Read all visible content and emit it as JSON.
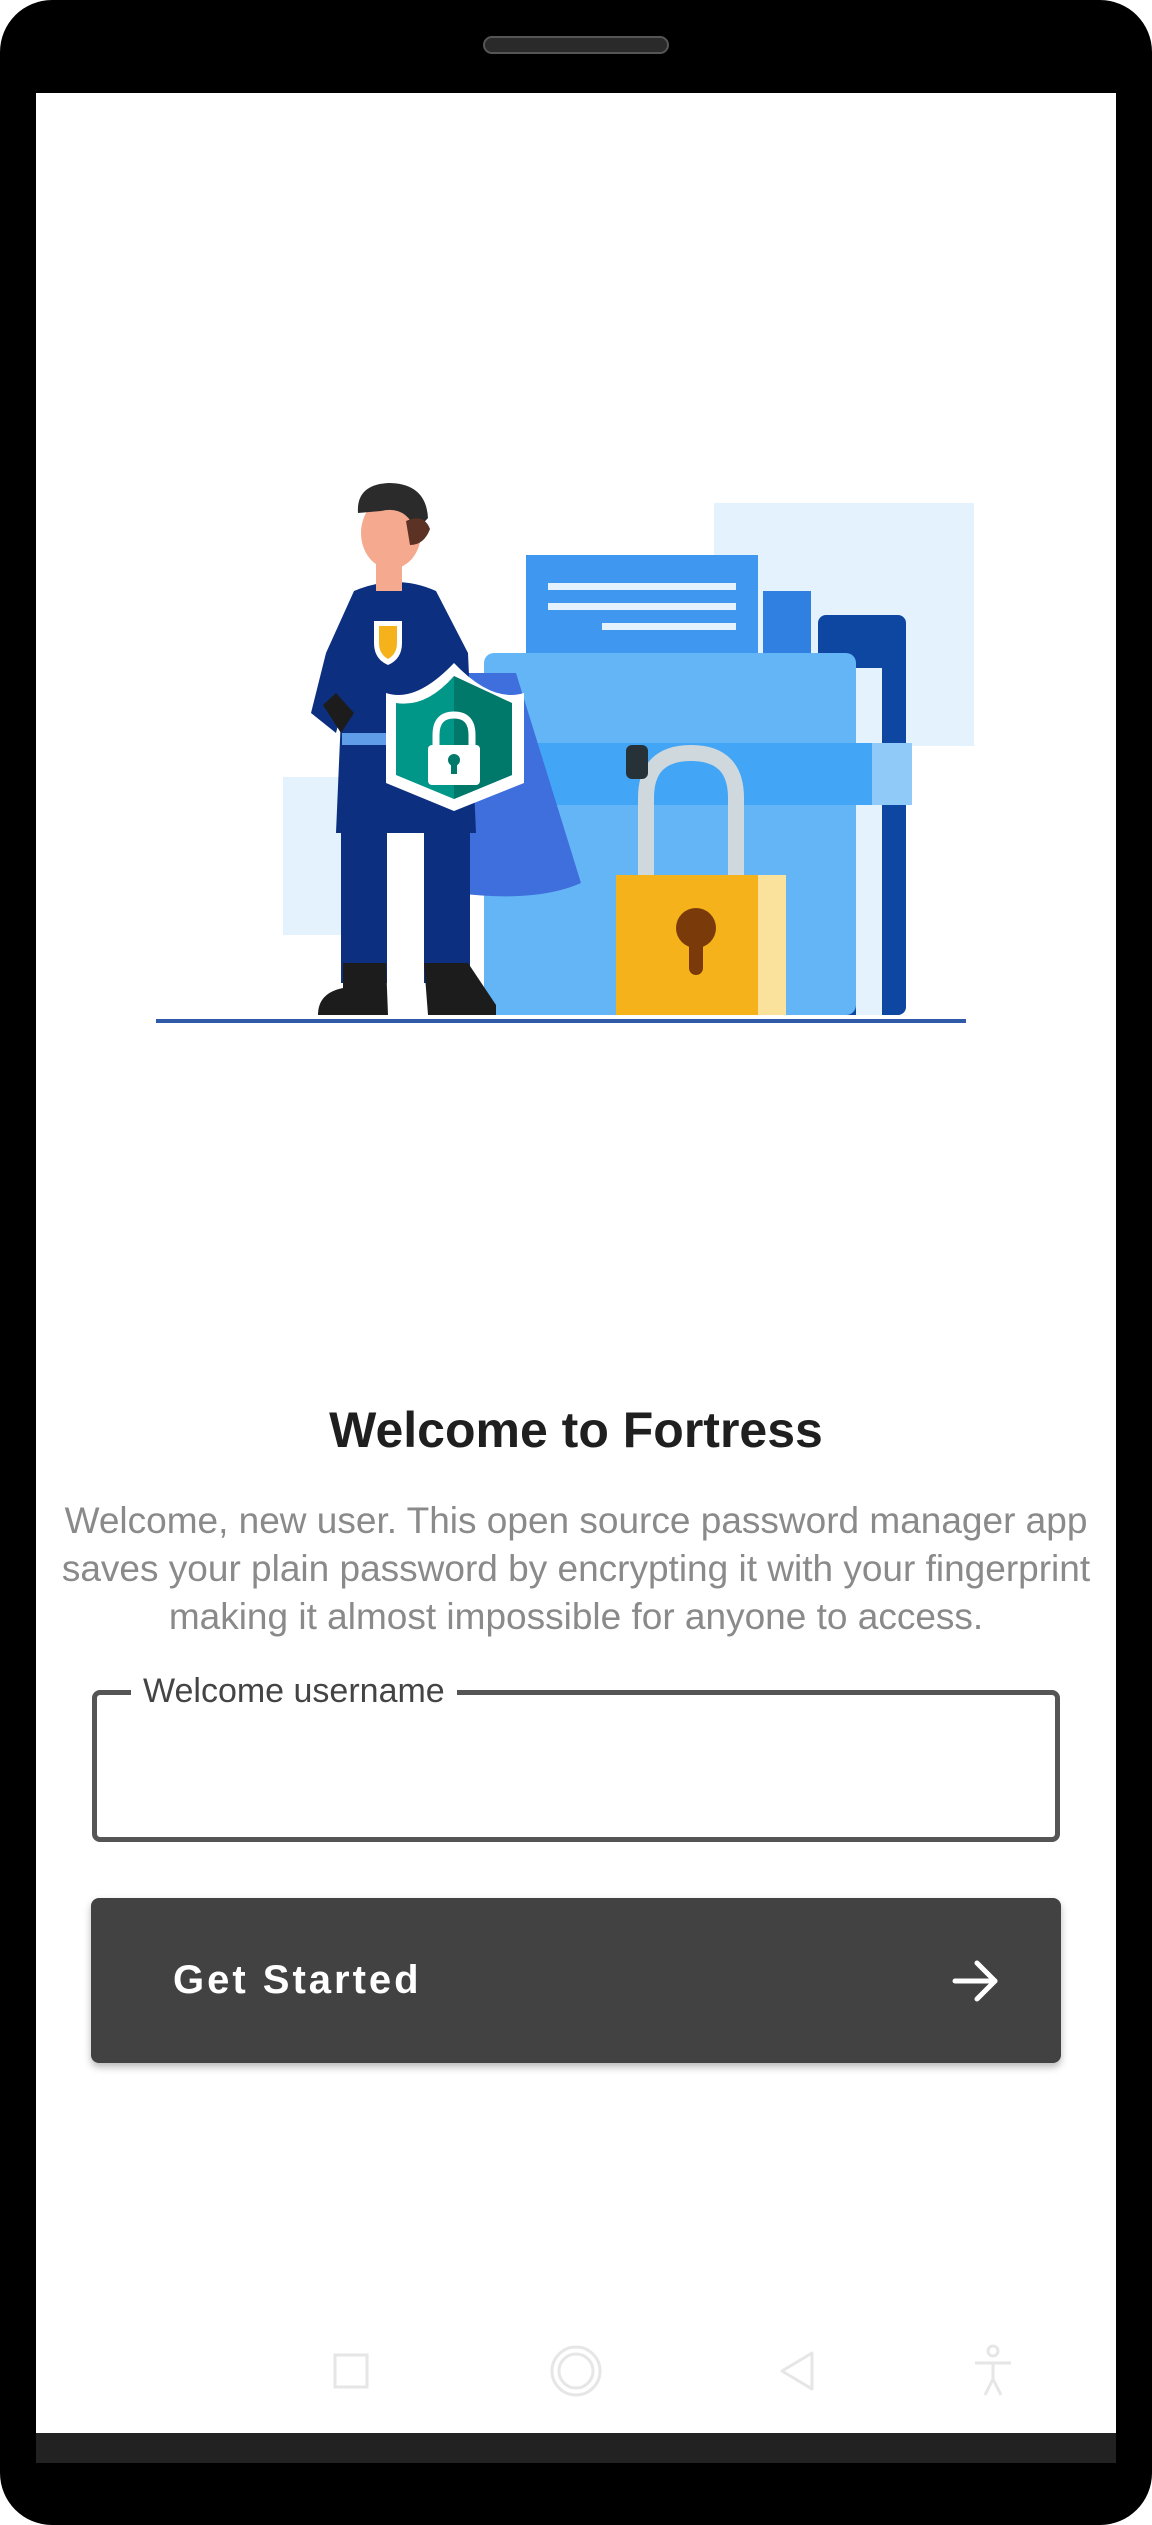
{
  "welcome": {
    "title": "Welcome to Fortress",
    "description": "Welcome, new user. This open source password manager app saves your plain password by encrypting it with your fingerprint making it almost impossible for anyone to access."
  },
  "username_field": {
    "label": "Welcome username",
    "value": ""
  },
  "get_started_button": {
    "label": "Get Started",
    "icon": "arrow-right-icon"
  },
  "navigation_bar": {
    "icons": [
      "recent-apps-icon",
      "home-icon",
      "back-icon",
      "accessibility-icon"
    ]
  },
  "colors": {
    "button": "#424242",
    "title": "#1f1f1f",
    "description": "#8a8a8a",
    "field_border": "#555555",
    "accent_blue": "#64b5f6",
    "hero_navy": "#0d2f80",
    "shield_teal": "#009688",
    "lock_gold": "#f6b21a"
  }
}
